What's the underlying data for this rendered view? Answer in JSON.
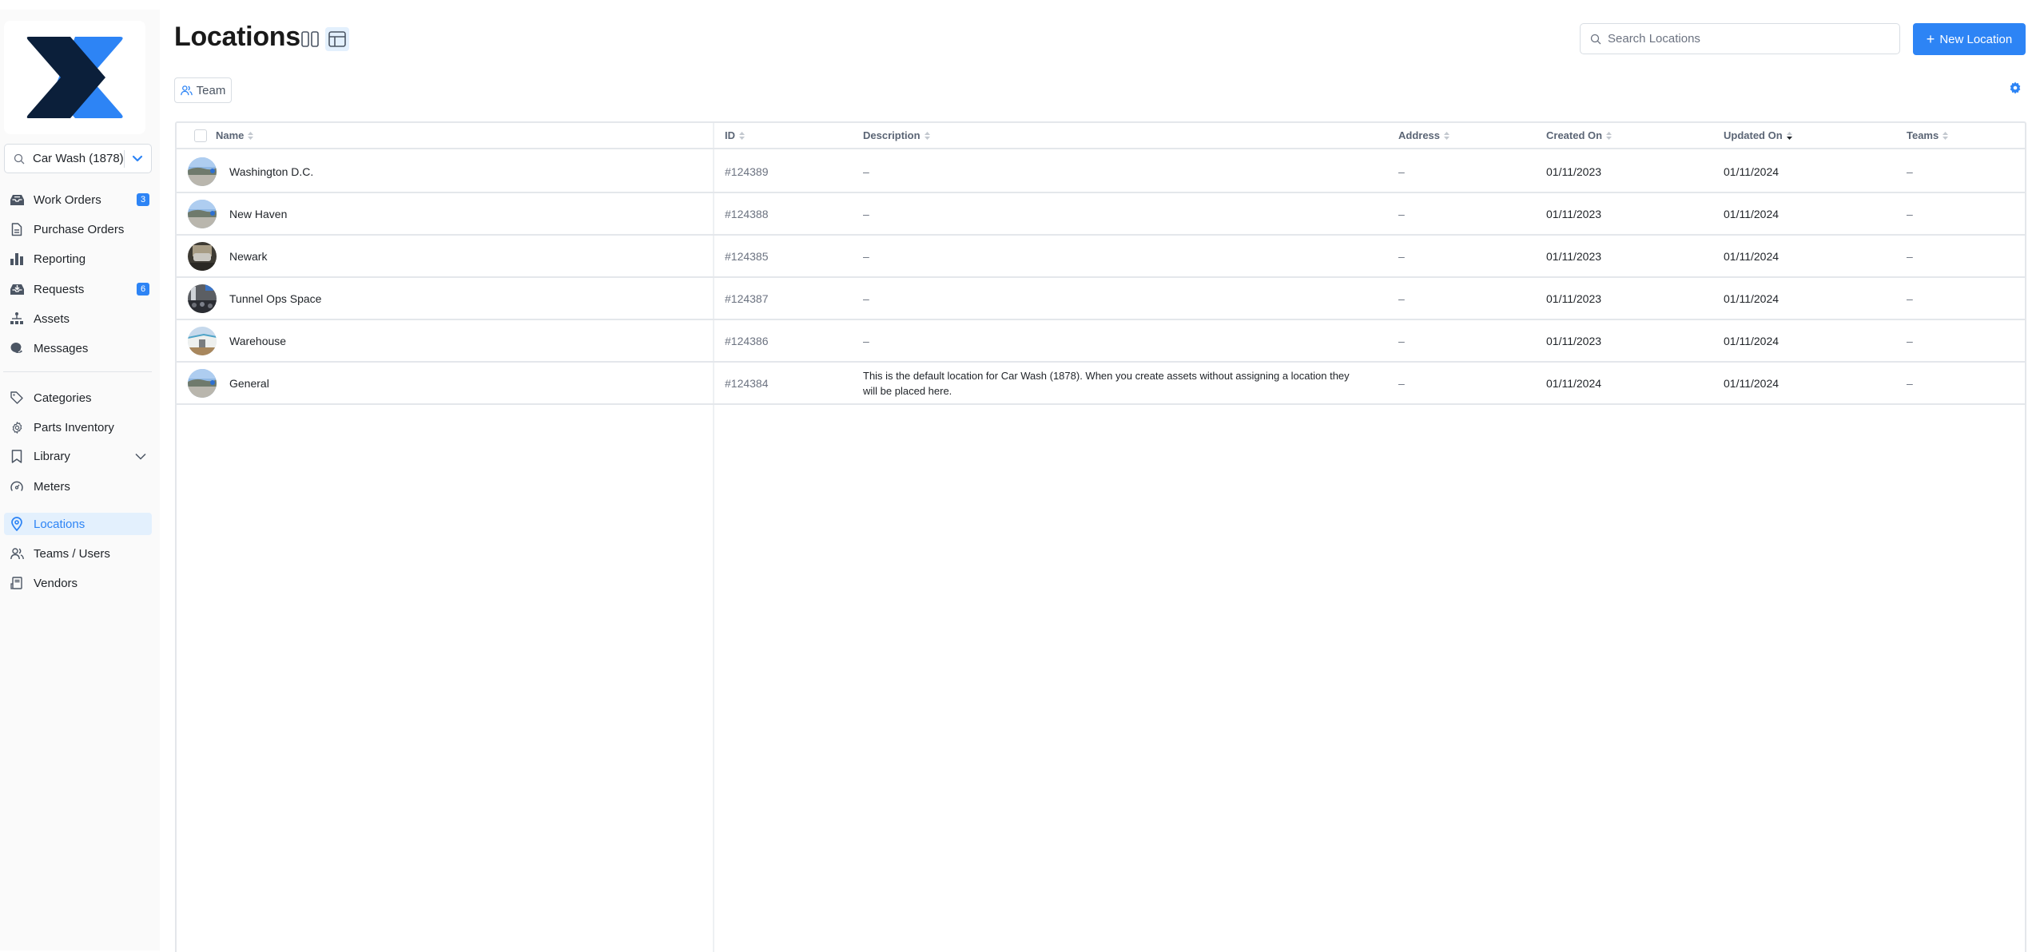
{
  "company_selector": {
    "label": "Car Wash (1878)"
  },
  "sidebar": {
    "items": [
      {
        "label": "Work Orders",
        "icon": "inbox-icon",
        "badge": "3"
      },
      {
        "label": "Purchase Orders",
        "icon": "document-icon"
      },
      {
        "label": "Reporting",
        "icon": "bar-chart-icon"
      },
      {
        "label": "Requests",
        "icon": "inbox-download-icon",
        "badge": "6"
      },
      {
        "label": "Assets",
        "icon": "hierarchy-icon"
      },
      {
        "label": "Messages",
        "icon": "chat-bubble-icon"
      },
      {
        "label": "Categories",
        "icon": "tag-icon"
      },
      {
        "label": "Parts Inventory",
        "icon": "gear-icon"
      },
      {
        "label": "Library",
        "icon": "bookmark-icon",
        "expandable": true
      },
      {
        "label": "Meters",
        "icon": "gauge-icon"
      },
      {
        "label": "Locations",
        "icon": "map-pin-icon",
        "active": true
      },
      {
        "label": "Teams / Users",
        "icon": "users-icon"
      },
      {
        "label": "Vendors",
        "icon": "vendor-icon"
      }
    ]
  },
  "header": {
    "title": "Locations",
    "view_toggles": [
      "split-view-icon",
      "table-view-icon"
    ],
    "active_view": "table-view-icon",
    "search_placeholder": "Search Locations",
    "new_button_label": "New Location",
    "filters": [
      {
        "label": "Team",
        "icon": "users-icon"
      }
    ]
  },
  "colors": {
    "accent": "#2d84f5",
    "active_bg": "#e3f0fd",
    "logo_dark": "#0b1f3a",
    "logo_blue": "#2d84f5"
  },
  "table": {
    "columns": [
      {
        "label": "Name",
        "sort": "none"
      },
      {
        "label": "ID",
        "sort": "none"
      },
      {
        "label": "Description",
        "sort": "none"
      },
      {
        "label": "Address",
        "sort": "none"
      },
      {
        "label": "Created On",
        "sort": "none"
      },
      {
        "label": "Updated On",
        "sort": "desc"
      },
      {
        "label": "Teams",
        "sort": "none"
      }
    ],
    "rows": [
      {
        "name": "Washington D.C.",
        "id": "#124389",
        "description": "–",
        "address": "–",
        "created_on": "01/11/2023",
        "updated_on": "01/11/2024",
        "teams": "–",
        "thumb": "sky"
      },
      {
        "name": "New Haven",
        "id": "#124388",
        "description": "–",
        "address": "–",
        "created_on": "01/11/2023",
        "updated_on": "01/11/2024",
        "teams": "–",
        "thumb": "sky"
      },
      {
        "name": "Newark",
        "id": "#124385",
        "description": "–",
        "address": "–",
        "created_on": "01/11/2023",
        "updated_on": "01/11/2024",
        "teams": "–",
        "thumb": "garage"
      },
      {
        "name": "Tunnel Ops Space",
        "id": "#124387",
        "description": "–",
        "address": "–",
        "created_on": "01/11/2023",
        "updated_on": "01/11/2024",
        "teams": "–",
        "thumb": "crowd"
      },
      {
        "name": "Warehouse",
        "id": "#124386",
        "description": "–",
        "address": "–",
        "created_on": "01/11/2023",
        "updated_on": "01/11/2024",
        "teams": "–",
        "thumb": "warehouse"
      },
      {
        "name": "General",
        "id": "#124384",
        "description": "This is the default location for Car Wash (1878). When you create assets without assigning a location they will be placed here.",
        "address": "–",
        "created_on": "01/11/2024",
        "updated_on": "01/11/2024",
        "teams": "–",
        "thumb": "sky"
      }
    ]
  }
}
